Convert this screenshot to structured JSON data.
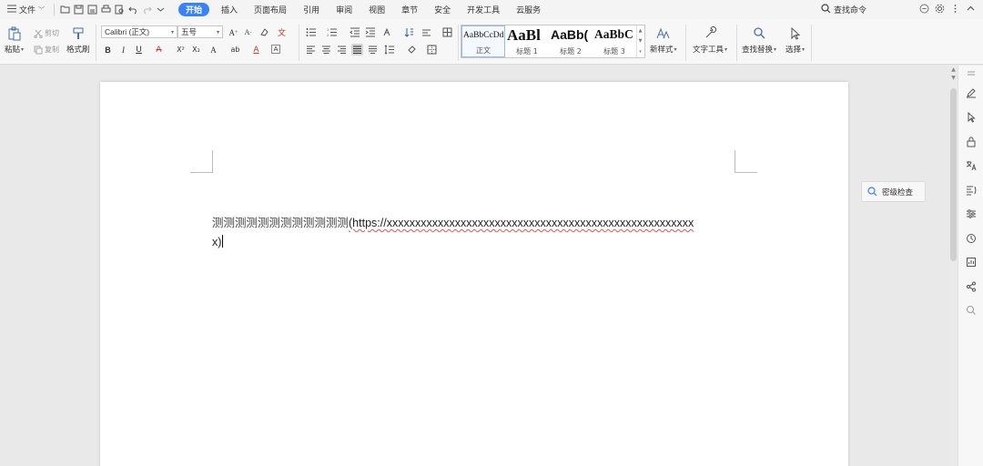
{
  "menubar": {
    "file_label": "文件",
    "tabs": [
      {
        "label": "开始",
        "active": true
      },
      {
        "label": "插入",
        "active": false
      },
      {
        "label": "页面布局",
        "active": false
      },
      {
        "label": "引用",
        "active": false
      },
      {
        "label": "审阅",
        "active": false
      },
      {
        "label": "视图",
        "active": false
      },
      {
        "label": "章节",
        "active": false
      },
      {
        "label": "安全",
        "active": false
      },
      {
        "label": "开发工具",
        "active": false
      },
      {
        "label": "云服务",
        "active": false
      }
    ],
    "search_label": "查找命令"
  },
  "ribbon": {
    "paste_label": "粘贴",
    "cut_label": "剪切",
    "copy_label": "复制",
    "format_painter_label": "格式刷",
    "font_name": "Calibri (正文)",
    "font_size": "五号",
    "styles": [
      {
        "sample": "AaBbCcDd",
        "name": "正文"
      },
      {
        "sample": "AaBl",
        "name": "标题 1"
      },
      {
        "sample": "AaBb(",
        "name": "标题 2"
      },
      {
        "sample": "AaBbC",
        "name": "标题 3"
      }
    ],
    "new_style_label": "新样式",
    "text_tools_label": "文字工具",
    "find_replace_label": "查找替换",
    "select_label": "选择"
  },
  "document": {
    "text_cjk": "测测测测测测测测测测测测",
    "text_url": "(https://xxxxxxxxxxxxxxxxxxxxxxxxxxxxxxxxxxxxxxxxxxxxxxxxxxxxxx",
    "text_tail": "x)"
  },
  "side": {
    "secret_check_label": "密级检查"
  },
  "colors": {
    "accent": "#3b82f6",
    "spell_underline": "#e25353"
  }
}
